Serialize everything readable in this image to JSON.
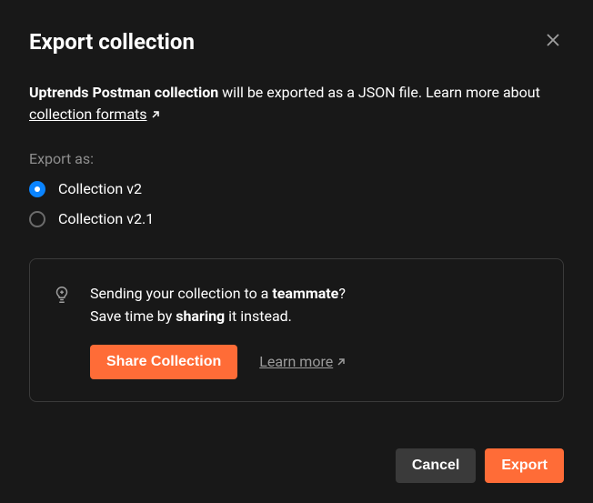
{
  "header": {
    "title": "Export collection"
  },
  "description": {
    "collection_name": "Uptrends Postman collection",
    "text_mid": " will be exported as a JSON file. Learn more about ",
    "link_text": "collection formats"
  },
  "export": {
    "label": "Export as:",
    "options": [
      {
        "label": "Collection v2",
        "selected": true
      },
      {
        "label": "Collection v2.1",
        "selected": false
      }
    ]
  },
  "info": {
    "line1_a": "Sending your collection to a ",
    "line1_b": "teammate",
    "line1_c": "?",
    "line2_a": "Save time by ",
    "line2_b": "sharing",
    "line2_c": " it instead.",
    "share_button": "Share Collection",
    "learn_more": "Learn more"
  },
  "footer": {
    "cancel": "Cancel",
    "export": "Export"
  }
}
